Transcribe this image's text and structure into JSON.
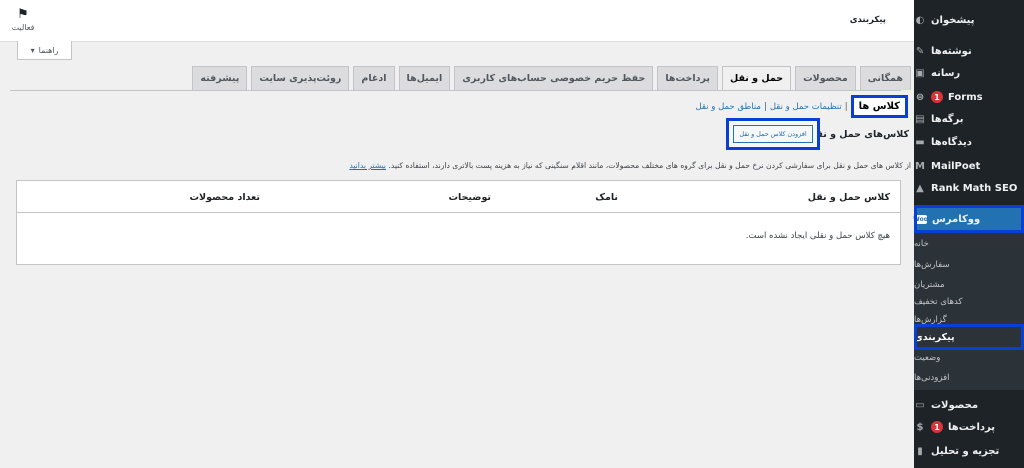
{
  "sidebar": {
    "items": [
      {
        "label": "پیشخوان",
        "icon": "dashboard-icon",
        "glyph": "◐"
      },
      {
        "label": "نوشته‌ها",
        "icon": "pin-icon",
        "glyph": "✎"
      },
      {
        "label": "رسانه",
        "icon": "media-icon",
        "glyph": "▣"
      },
      {
        "label": "Forms",
        "icon": "forms-icon",
        "glyph": "⊜",
        "badge": "1"
      },
      {
        "label": "برگه‌ها",
        "icon": "pages-icon",
        "glyph": "▤"
      },
      {
        "label": "دیدگاه‌ها",
        "icon": "comments-icon",
        "glyph": "▬"
      },
      {
        "label": "MailPoet",
        "icon": "mailpoet-icon",
        "glyph": "M"
      },
      {
        "label": "Rank Math SEO",
        "icon": "rankmath-icon",
        "glyph": "▲"
      },
      {
        "label": "ووکامرس",
        "icon": "woo-icon",
        "glyph": "Woo"
      }
    ],
    "submenu": [
      "خانه",
      "سفارش‌ها",
      "مشتریان",
      "کدهای تخفیف",
      "گزارش‌ها",
      "پیکربندی",
      "وضعیت",
      "افزودنی‌ها"
    ],
    "submenu_current": "پیکربندی",
    "bottom_items": [
      {
        "label": "محصولات",
        "icon": "products-icon",
        "glyph": "▭"
      },
      {
        "label": "پرداخت‌ها",
        "icon": "payments-icon",
        "glyph": "$",
        "badge": "1"
      },
      {
        "label": "تجزیه و تحلیل",
        "icon": "analytics-icon",
        "glyph": "▮"
      }
    ]
  },
  "header": {
    "title": "پیکربندی",
    "activity_label": "فعالیت"
  },
  "help": {
    "label": "راهنما",
    "arrow": "▾"
  },
  "tabs": [
    {
      "label": "همگانی",
      "active": false
    },
    {
      "label": "محصولات",
      "active": false
    },
    {
      "label": "حمل و نقل",
      "active": true
    },
    {
      "label": "پرداخت‌ها",
      "active": false
    },
    {
      "label": "حفظ حریم خصوصی حساب‌های کاربری",
      "active": false
    },
    {
      "label": "ایمیل‌ها",
      "active": false
    },
    {
      "label": "ادغام",
      "active": false
    },
    {
      "label": "روئت‌پذیری سایت",
      "active": false
    },
    {
      "label": "پیشرفته",
      "active": false
    }
  ],
  "subsections": {
    "links": [
      "مناطق حمل و نقل",
      "تنظیمات حمل و نقل"
    ],
    "separator": "|",
    "current": "کلاس ها"
  },
  "section": {
    "title": "کلاس‌های حمل و نقل",
    "add_button": "افزودن کلاس حمل و نقل",
    "description": "از کلاس های حمل و نقل برای سفارشی کردن نرخ حمل و نقل برای گروه های مختلف محصولات، مانند اقلام سنگینی که نیاز به هزینه پست بالاتری دارند، استفاده کنید.",
    "learn_more": "بیشتر بدانید"
  },
  "table": {
    "columns": [
      "کلاس حمل و نقل",
      "نامک",
      "توضیحات",
      "تعداد محصولات"
    ],
    "empty_message": "هیچ کلاس حمل و نقلی ایجاد نشده است."
  }
}
